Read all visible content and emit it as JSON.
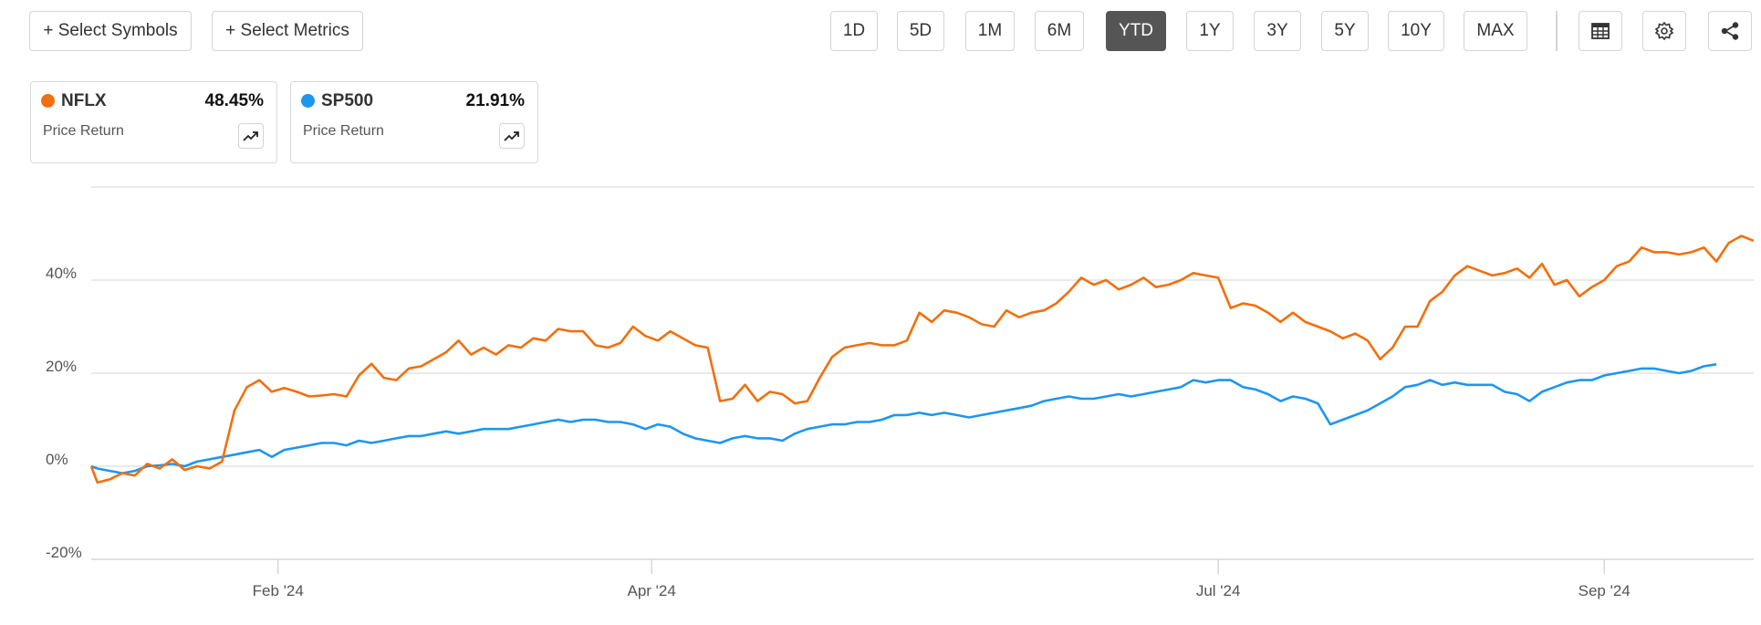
{
  "toolbar": {
    "select_symbols": "+ Select Symbols",
    "select_metrics": "+ Select Metrics",
    "ranges": [
      "1D",
      "5D",
      "1M",
      "6M",
      "YTD",
      "1Y",
      "3Y",
      "5Y",
      "10Y",
      "MAX"
    ],
    "active_range": "YTD",
    "icons": [
      "table-icon",
      "gear-icon",
      "share-icon"
    ]
  },
  "legend": [
    {
      "symbol": "NFLX",
      "value": "48.45%",
      "metric": "Price Return",
      "color": "#f26f0d"
    },
    {
      "symbol": "SP500",
      "value": "21.91%",
      "metric": "Price Return",
      "color": "#1e96f0"
    }
  ],
  "chart_data": {
    "type": "line",
    "xlabel": "",
    "ylabel": "",
    "x_ticks": [
      "Feb '24",
      "Apr '24",
      "Jul '24",
      "Sep '24"
    ],
    "x_tick_days": [
      31,
      91,
      182,
      244
    ],
    "x_range_days": [
      1,
      268
    ],
    "y_ticks": [
      "40%",
      "20%",
      "0%",
      "-20%"
    ],
    "y_tick_values": [
      40,
      20,
      0,
      -20
    ],
    "ylim": [
      -20,
      60
    ],
    "grid": true,
    "series": [
      {
        "name": "NFLX",
        "color": "#f26f0d",
        "x_days": [
          1,
          2,
          4,
          6,
          8,
          10,
          12,
          14,
          16,
          18,
          20,
          22,
          24,
          26,
          28,
          30,
          32,
          34,
          36,
          38,
          40,
          42,
          44,
          46,
          48,
          50,
          52,
          54,
          56,
          58,
          60,
          62,
          64,
          66,
          68,
          70,
          72,
          74,
          76,
          78,
          80,
          82,
          84,
          86,
          88,
          90,
          92,
          94,
          96,
          98,
          100,
          102,
          104,
          106,
          108,
          110,
          112,
          114,
          116,
          118,
          120,
          122,
          124,
          126,
          128,
          130,
          132,
          134,
          136,
          138,
          140,
          142,
          144,
          146,
          148,
          150,
          152,
          154,
          156,
          158,
          160,
          162,
          164,
          166,
          168,
          170,
          172,
          174,
          176,
          178,
          180,
          182,
          184,
          186,
          188,
          190,
          192,
          194,
          196,
          198,
          200,
          202,
          204,
          206,
          208,
          210,
          212,
          214,
          216,
          218,
          220,
          222,
          224,
          226,
          228,
          230,
          232,
          234,
          236,
          238,
          240,
          242,
          244,
          246,
          248,
          250,
          252,
          254,
          256,
          258,
          260,
          262,
          264,
          266,
          268
        ],
        "values": [
          0,
          -3.5,
          -2.8,
          -1.5,
          -2,
          0.5,
          -0.5,
          1.5,
          -0.8,
          0,
          -0.5,
          1,
          12,
          17,
          18.5,
          16,
          16.8,
          16,
          15,
          15.2,
          15.5,
          15,
          19.5,
          22,
          19,
          18.5,
          21,
          21.5,
          23,
          24.5,
          27,
          24,
          25.5,
          24,
          26,
          25.5,
          27.5,
          27,
          29.5,
          29,
          29,
          26,
          25.5,
          26.5,
          30,
          28,
          27,
          29,
          27.5,
          26,
          25.5,
          14,
          14.5,
          17.5,
          14,
          16,
          15.5,
          13.5,
          14,
          19,
          23.5,
          25.5,
          26,
          26.5,
          26,
          26,
          27,
          33,
          31,
          33.5,
          33,
          32,
          30.5,
          30,
          33.5,
          32,
          33,
          33.5,
          35,
          37.5,
          40.5,
          39,
          40,
          38,
          39,
          40.5,
          38.5,
          39,
          40,
          41.5,
          41,
          40.5,
          34,
          35,
          34.5,
          33,
          31,
          33,
          31,
          30,
          29,
          27.5,
          28.5,
          27,
          23,
          25.5,
          30,
          30,
          35.5,
          37.5,
          41,
          43,
          42,
          41,
          41.5,
          42.5,
          40.5,
          43.5,
          39,
          40,
          36.5,
          38.5,
          40,
          43,
          44,
          47,
          46,
          46,
          45.5,
          46,
          47,
          44,
          48,
          49.5,
          48.45
        ]
      },
      {
        "name": "SP500",
        "color": "#1e96f0",
        "x_days": [
          1,
          2,
          4,
          6,
          8,
          10,
          12,
          14,
          16,
          18,
          20,
          22,
          24,
          26,
          28,
          30,
          32,
          34,
          36,
          38,
          40,
          42,
          44,
          46,
          48,
          50,
          52,
          54,
          56,
          58,
          60,
          62,
          64,
          66,
          68,
          70,
          72,
          74,
          76,
          78,
          80,
          82,
          84,
          86,
          88,
          90,
          92,
          94,
          96,
          98,
          100,
          102,
          104,
          106,
          108,
          110,
          112,
          114,
          116,
          118,
          120,
          122,
          124,
          126,
          128,
          130,
          132,
          134,
          136,
          138,
          140,
          142,
          144,
          146,
          148,
          150,
          152,
          154,
          156,
          158,
          160,
          162,
          164,
          166,
          168,
          170,
          172,
          174,
          176,
          178,
          180,
          182,
          184,
          186,
          188,
          190,
          192,
          194,
          196,
          198,
          200,
          202,
          204,
          206,
          208,
          210,
          212,
          214,
          216,
          218,
          220,
          222,
          224,
          226,
          228,
          230,
          232,
          234,
          236,
          238,
          240,
          242,
          244,
          246,
          248,
          250,
          252,
          254,
          256,
          258,
          260,
          262,
          264,
          266,
          268
        ],
        "values": [
          0,
          -0.5,
          -1,
          -1.5,
          -1,
          0,
          0.2,
          0.5,
          0,
          1,
          1.5,
          2,
          2.5,
          3,
          3.5,
          2,
          3.5,
          4,
          4.5,
          5,
          5,
          4.5,
          5.5,
          5,
          5.5,
          6,
          6.5,
          6.5,
          7,
          7.5,
          7,
          7.5,
          8,
          8,
          8,
          8.5,
          9,
          9.5,
          10,
          9.5,
          10,
          10,
          9.5,
          9.5,
          9,
          8,
          9,
          8.5,
          7,
          6,
          5.5,
          5,
          6,
          6.5,
          6,
          6,
          5.5,
          7,
          8,
          8.5,
          9,
          9,
          9.5,
          9.5,
          10,
          11,
          11,
          11.5,
          11,
          11.5,
          11,
          10.5,
          11,
          11.5,
          12,
          12.5,
          13,
          14,
          14.5,
          15,
          14.5,
          14.5,
          15,
          15.5,
          15,
          15.5,
          16,
          16.5,
          17,
          18.5,
          18,
          18.5,
          18.5,
          17,
          16.5,
          15.5,
          14,
          15,
          14.5,
          13.5,
          9,
          10,
          11,
          12,
          13.5,
          15,
          17,
          17.5,
          18.5,
          17.5,
          18,
          17.5,
          17.5,
          17.5,
          16,
          15.5,
          14,
          16,
          17,
          18,
          18.5,
          18.5,
          19.5,
          20,
          20.5,
          21,
          21,
          20.5,
          20,
          20.5,
          21.5,
          21.91
        ]
      }
    ]
  }
}
